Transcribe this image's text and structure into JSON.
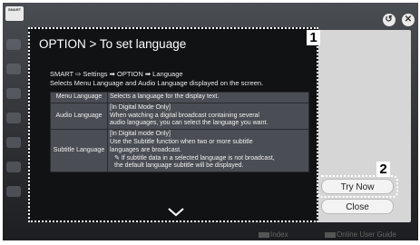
{
  "logo": {
    "text": "SMART"
  },
  "dialog": {
    "title": "OPTION > To set language",
    "path": "SMART ⇨ Settings ➡ OPTION ➡ Language",
    "description": "Selects Menu Language and Audio Language displayed on the screen.",
    "rows": [
      {
        "label": "Menu Language",
        "lines": [
          "Selects a language for the display text."
        ]
      },
      {
        "label": "Audio Language",
        "lines": [
          "[In Digital Mode Only]",
          "When watching a digital broadcast containing several",
          "audio languages, you can select the language you want."
        ]
      },
      {
        "label": "Subtitle Language",
        "lines": [
          "[In Digital mode Only]",
          "Use the Subtitle function when two or more subtitle",
          "languages are broadcast.",
          "If subtitle data in a selected language is not broadcast,",
          "the default language subtitle will be displayed."
        ]
      }
    ],
    "scroll_icon": "chevron-down-icon"
  },
  "badges": {
    "one": "1",
    "two": "2"
  },
  "buttons": {
    "try_now": "Try Now",
    "close": "Close"
  },
  "top_icons": [
    "back-icon",
    "close-icon"
  ],
  "footer": {
    "index": "Index",
    "guide": "Online User Guide"
  }
}
